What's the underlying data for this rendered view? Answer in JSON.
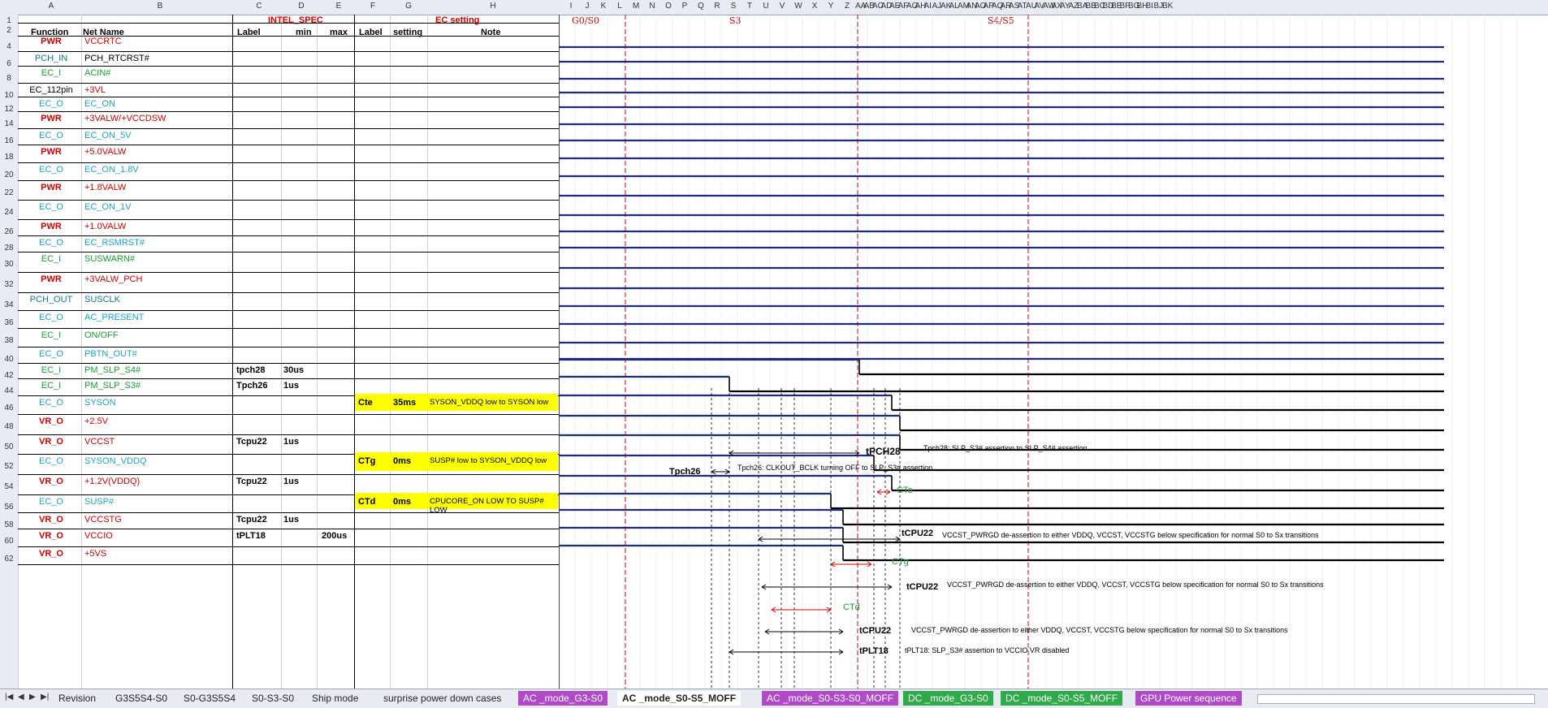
{
  "col_headers": [
    "A",
    "B",
    "C",
    "D",
    "E",
    "F",
    "G",
    "H",
    "I",
    "J",
    "K",
    "L",
    "M",
    "N",
    "O",
    "P",
    "Q",
    "R",
    "S",
    "T",
    "U",
    "V",
    "W",
    "X",
    "Y",
    "Z",
    "AA",
    "AB",
    "AC",
    "AD",
    "AE",
    "AF",
    "AG",
    "AH",
    "AI",
    "AJ",
    "AK",
    "AL",
    "AM",
    "AN",
    "AO",
    "AP",
    "AQ",
    "AR",
    "AS",
    "AT",
    "AU",
    "AV",
    "AW",
    "AX",
    "AY",
    "AZ",
    "BA",
    "BB",
    "BC",
    "BD",
    "BE",
    "BF",
    "BG",
    "BH",
    "BI",
    "BJ",
    "BK"
  ],
  "row_numbers": [
    "1",
    "2",
    "4",
    "6",
    "8",
    "10",
    "12",
    "14",
    "16",
    "18",
    "20",
    "22",
    "24",
    "26",
    "28",
    "30",
    "32",
    "34",
    "36",
    "38",
    "40",
    "42",
    "44",
    "46",
    "48",
    "50",
    "52",
    "54",
    "56",
    "58",
    "60",
    "62"
  ],
  "header": {
    "intel_spec": "INTEL_SPEC",
    "ec_setting": "EC setting",
    "function": "Function",
    "net_name": "Net Name",
    "label": "Label",
    "min": "min",
    "max": "max",
    "ec_label": "Label",
    "setting": "setting",
    "note": "Note",
    "state_g0s0": "G0/S0",
    "state_s3": "S3",
    "state_s4s5": "S4/S5"
  },
  "rows": [
    {
      "func": "PWR",
      "net": "VCCRTC",
      "fc": "pwr",
      "nc": "pwr"
    },
    {
      "func": "PCH_IN",
      "net": "PCH_RTCRST#",
      "fc": "teal",
      "nc": "black"
    },
    {
      "func": "EC_I",
      "net": "ACIN#",
      "fc": "green",
      "nc": "green"
    },
    {
      "func": "EC_112pin",
      "net": "+3VL",
      "fc": "black",
      "nc": "pwr"
    },
    {
      "func": "EC_O",
      "net": "EC_ON",
      "fc": "cyan",
      "nc": "cyan"
    },
    {
      "func": "PWR",
      "net": "+3VALW/+VCCDSW",
      "fc": "pwr",
      "nc": "pwr"
    },
    {
      "func": "EC_O",
      "net": "EC_ON_5V",
      "fc": "cyan",
      "nc": "cyan"
    },
    {
      "func": "PWR",
      "net": "+5.0VALW",
      "fc": "pwr",
      "nc": "pwr"
    },
    {
      "func": "EC_O",
      "net": "EC_ON_1.8V",
      "fc": "cyan",
      "nc": "cyan"
    },
    {
      "func": "PWR",
      "net": "+1.8VALW",
      "fc": "pwr",
      "nc": "pwr"
    },
    {
      "func": "EC_O",
      "net": "EC_ON_1V",
      "fc": "cyan",
      "nc": "cyan"
    },
    {
      "func": "PWR",
      "net": "+1.0VALW",
      "fc": "pwr",
      "nc": "pwr"
    },
    {
      "func": "EC_O",
      "net": "EC_RSMRST#",
      "fc": "cyan",
      "nc": "cyan"
    },
    {
      "func": "EC_I",
      "net": "SUSWARN#",
      "fc": "green",
      "nc": "green"
    },
    {
      "func": "PWR",
      "net": "+3VALW_PCH",
      "fc": "pwr",
      "nc": "pwr"
    },
    {
      "func": "PCH_OUT",
      "net": "SUSCLK",
      "fc": "teal",
      "nc": "teal"
    },
    {
      "func": "EC_O",
      "net": "AC_PRESENT",
      "fc": "cyan",
      "nc": "cyan"
    },
    {
      "func": "EC_I",
      "net": "ON/OFF",
      "fc": "green",
      "nc": "green"
    },
    {
      "func": "EC_O",
      "net": "PBTN_OUT#",
      "fc": "cyan",
      "nc": "cyan"
    },
    {
      "func": "EC_I",
      "net": "PM_SLP_S4#",
      "fc": "green",
      "nc": "green",
      "label": "tpch28",
      "min": "30us"
    },
    {
      "func": "EC_I",
      "net": "PM_SLP_S3#",
      "fc": "green",
      "nc": "green",
      "label": "Tpch26",
      "min": "1us"
    },
    {
      "func": "EC_O",
      "net": "SYSON",
      "fc": "cyan",
      "nc": "cyan",
      "eclabel": "Cte",
      "setting": "35ms",
      "note": "SYSON_VDDQ low to SYSON low"
    },
    {
      "func": "VR_O",
      "net": "+2.5V",
      "fc": "pwr",
      "nc": "pwr"
    },
    {
      "func": "VR_O",
      "net": "VCCST",
      "fc": "pwr",
      "nc": "pwr",
      "label": "Tcpu22",
      "min": "1us"
    },
    {
      "func": "EC_O",
      "net": "SYSON_VDDQ",
      "fc": "cyan",
      "nc": "cyan",
      "eclabel": "CTg",
      "setting": "0ms",
      "note": "SUSP# low to SYSON_VDDQ low"
    },
    {
      "func": "VR_O",
      "net": "+1.2V(VDDQ)",
      "fc": "pwr",
      "nc": "pwr",
      "label": "Tcpu22",
      "min": "1us"
    },
    {
      "func": "EC_O",
      "net": "SUSP#",
      "fc": "cyan",
      "nc": "cyan",
      "eclabel": "CTd",
      "setting": "0ms",
      "note": "CPUCORE_ON LOW TO SUSP# LOW"
    },
    {
      "func": "VR_O",
      "net": "VCCSTG",
      "fc": "pwr",
      "nc": "pwr",
      "label": "Tcpu22",
      "min": "1us"
    },
    {
      "func": "VR_O",
      "net": "VCCIO",
      "fc": "pwr",
      "nc": "pwr",
      "label": "tPLT18",
      "max": "200us"
    },
    {
      "func": "VR_O",
      "net": "+5VS",
      "fc": "pwr",
      "nc": "pwr"
    }
  ],
  "annotations": {
    "tpch28": "tPCH28",
    "tpch28_note": "Tpch28: SLP_S3# assertion to SLP_S4# assertion .",
    "tpch26": "Tpch26",
    "tpch26_note": "Tpch26: CLKOUT_BCLK turning OFF to SLP_S3# assertion",
    "cte": "CTe",
    "tcpu22_a": "tCPU22",
    "tcpu22_a_note": "VCCST_PWRGD de-assertion to either VDDQ, VCCST, VCCSTG below specification for normal S0 to Sx transitions",
    "ctg": "CTg",
    "tcpu22_b": "tCPU22",
    "tcpu22_b_note": "VCCST_PWRGD de-assertion to either VDDQ, VCCST, VCCSTG below specification for normal S0 to Sx transitions",
    "ctd": "CTd",
    "tcpu22_c": "tCPU22",
    "tcpu22_c_note": "VCCST_PWRGD de-assertion to either VDDQ, VCCST, VCCSTG below specification for normal S0 to Sx transitions",
    "tplt18": "tPLT18",
    "tplt18_note": "tPLT18: SLP_S3# assertion to VCCIO VR disabled"
  },
  "tabs": [
    {
      "label": "Revision",
      "style": "plain"
    },
    {
      "label": "G3S5S4-S0",
      "style": "plain"
    },
    {
      "label": "S0-G3S5S4",
      "style": "plain"
    },
    {
      "label": "S0-S3-S0",
      "style": "plain"
    },
    {
      "label": "Ship mode",
      "style": "plain"
    },
    {
      "label": "surprise power down cases",
      "style": "plain"
    },
    {
      "label": "AC _mode_G3-S0",
      "style": "purple"
    },
    {
      "label": "AC _mode_S0-S5_MOFF",
      "style": "active"
    },
    {
      "label": "AC _mode_S0-S3-S0_MOFF",
      "style": "purple"
    },
    {
      "label": "DC _mode_G3-S0",
      "style": "green"
    },
    {
      "label": "DC _mode_S0-S5_MOFF",
      "style": "green"
    },
    {
      "label": "GPU Power sequence",
      "style": "purple"
    }
  ],
  "colors": {
    "wave": "#1f2a7a",
    "red": "#d40000",
    "cyan": "#1aa3d4",
    "green": "#17a032",
    "yellow": "#ffff00"
  }
}
